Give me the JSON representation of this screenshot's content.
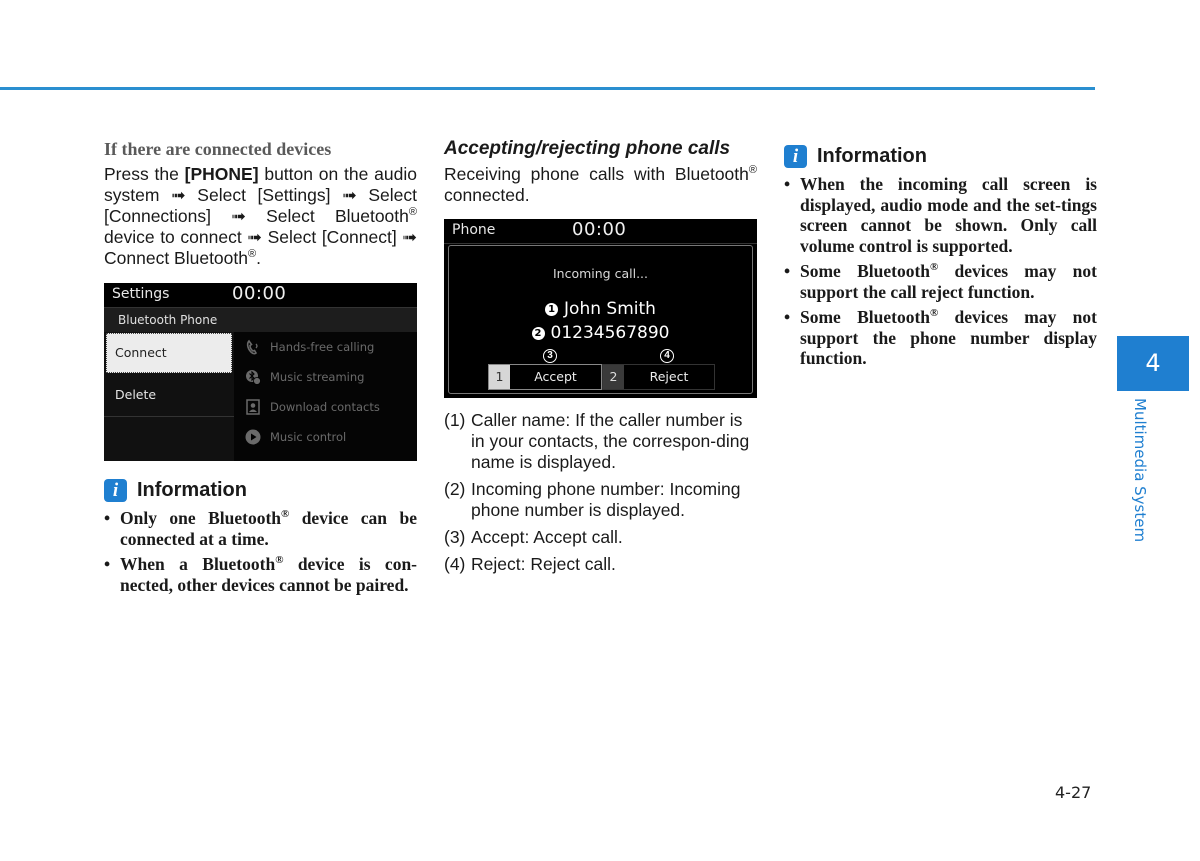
{
  "page": {
    "number": "4-27",
    "chapter_number": "4",
    "chapter_title": "Multimedia System",
    "accent_color": "#1f7fd0"
  },
  "col1": {
    "heading": "If there are connected devices",
    "para_parts": [
      "Press the ",
      "[PHONE]",
      " button on the audio system ➟ Select [Settings] ➟ Select [Connections] ➟ Select Bluetooth",
      "®",
      " device to connect ➟ Select [Connect] ➟ Connect Bluetooth",
      "®",
      "."
    ],
    "settings_screen": {
      "title": "Settings",
      "clock": "00:00",
      "subtitle": "Bluetooth Phone",
      "menu": [
        "Connect",
        "Delete"
      ],
      "selected_menu": "Connect",
      "features": [
        {
          "label": "Hands-free calling",
          "icon": "phone-handset-icon"
        },
        {
          "label": "Music streaming",
          "icon": "bluetooth-music-icon"
        },
        {
          "label": "Download contacts",
          "icon": "contacts-icon"
        },
        {
          "label": "Music control",
          "icon": "play-icon"
        }
      ]
    },
    "info": {
      "icon": "i",
      "title": "Information",
      "items": [
        [
          "Only one Bluetooth",
          "®",
          " device can be connected at a time."
        ],
        [
          "When a Bluetooth",
          "®",
          " device is con-nected, other devices cannot be paired."
        ]
      ]
    }
  },
  "col2": {
    "heading": "Accepting/rejecting phone calls",
    "para_parts": [
      "Receiving phone calls with Bluetooth",
      "®",
      " connected."
    ],
    "phone_screen": {
      "title": "Phone",
      "clock": "00:00",
      "status": "Incoming call...",
      "caller_name": "John Smith",
      "caller_number": "01234567890",
      "marker1": "1",
      "marker2": "2",
      "marker3": "3",
      "marker4": "4",
      "accept": {
        "key": "1",
        "label": "Accept"
      },
      "reject": {
        "key": "2",
        "label": "Reject"
      }
    },
    "legend": [
      {
        "num": "(1)",
        "text": "Caller name: If the caller number is in your contacts, the correspon-ding name is displayed."
      },
      {
        "num": "(2)",
        "text": "Incoming phone number: Incoming phone number is displayed."
      },
      {
        "num": "(3)",
        "text": "Accept: Accept call."
      },
      {
        "num": "(4)",
        "text": "Reject: Reject call."
      }
    ]
  },
  "col3": {
    "info": {
      "icon": "i",
      "title": "Information",
      "items": [
        [
          "When the incoming call screen is displayed, audio mode and the set-tings screen cannot be shown. Only call volume control is supported.",
          "",
          ""
        ],
        [
          "Some Bluetooth",
          "®",
          " devices may not support the call reject function."
        ],
        [
          "Some Bluetooth",
          "®",
          " devices may not support the phone number display function."
        ]
      ]
    }
  }
}
